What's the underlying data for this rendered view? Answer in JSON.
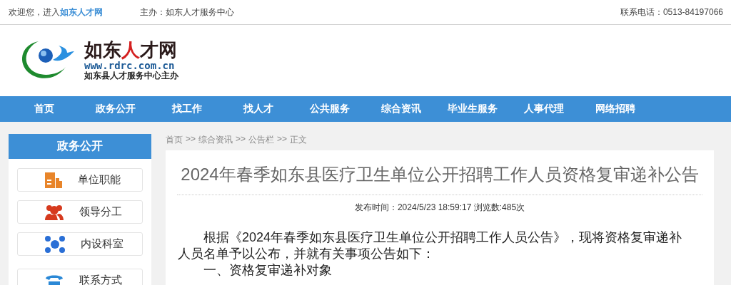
{
  "top_bar": {
    "welcome": "欢迎您，进入",
    "site_link": "如东人才网",
    "sponsor": "主办：如东人才服务中心",
    "phone": "联系电话：0513-84197066"
  },
  "logo": {
    "title_before": "如东",
    "title_highlight": "人",
    "title_after": "才网",
    "url": "www.rdrc.com.cn",
    "subtitle": "如东县人才服务中心主办"
  },
  "nav": [
    "首页",
    "政务公开",
    "找工作",
    "找人才",
    "公共服务",
    "综合资讯",
    "毕业生服务",
    "人事代理",
    "网络招聘"
  ],
  "sidebar": {
    "title": "政务公开",
    "items": [
      {
        "label": "单位职能",
        "kind": "building"
      },
      {
        "label": "领导分工",
        "kind": "people"
      },
      {
        "label": "内设科室",
        "kind": "network"
      },
      {
        "label": "联系方式",
        "kind": "phone"
      }
    ]
  },
  "breadcrumb": {
    "separator": ">>",
    "items": [
      "首页",
      "综合资讯",
      "公告栏",
      "正文"
    ]
  },
  "article": {
    "title": "2024年春季如东县医疗卫生单位公开招聘工作人员资格复审递补公告",
    "meta": "发布时间：2024/5/23 18:59:17 浏览数:485次",
    "paragraphs": [
      "根据《2024年春季如东县医疗卫生单位公开招聘工作人员公告》，现将资格复审递补人员名单予以公布，并就有关事项公告如下：",
      "一、资格复审递补对象"
    ]
  }
}
